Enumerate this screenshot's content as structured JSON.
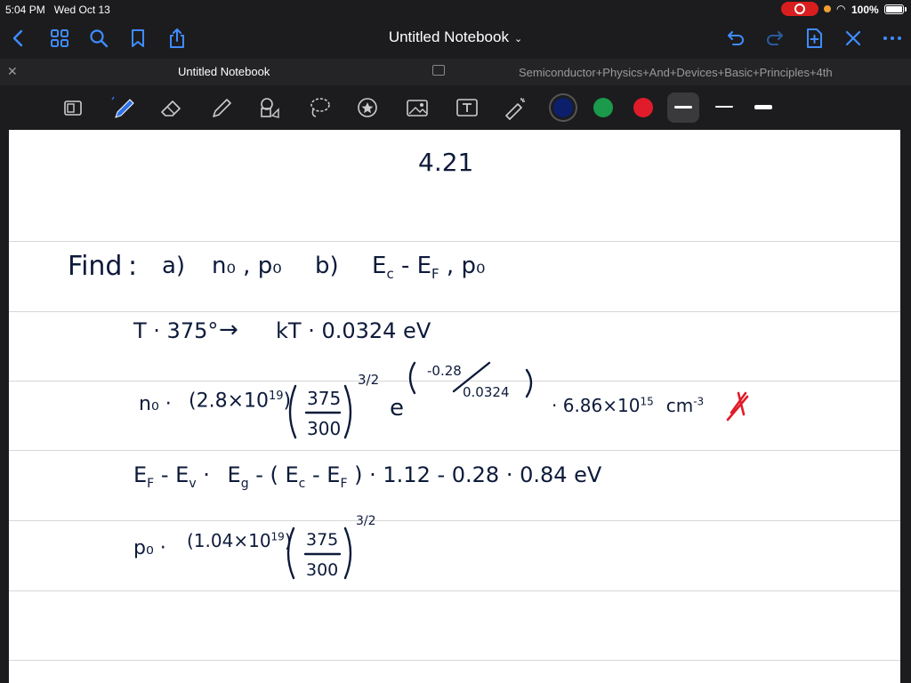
{
  "status_bar": {
    "time": "5:04 PM",
    "date": "Wed Oct 13",
    "battery": "100%"
  },
  "nav": {
    "title": "Untitled Notebook"
  },
  "tabs": [
    {
      "label": "Untitled Notebook"
    },
    {
      "label": "Semiconductor+Physics+And+Devices+Basic+Principles+4th"
    }
  ],
  "colors": {
    "accent": "#3f8cff",
    "ink": "#0d1a3a",
    "swatch_navy": "#0b1f6b",
    "swatch_green": "#1a9a4a",
    "swatch_red": "#e01c2a"
  },
  "note": {
    "problem_number": "4.21",
    "find": {
      "label": "Find",
      "colon": ":",
      "a_label": "a)",
      "a_text": "n₀ , p₀",
      "b_label": "b)",
      "b_text": "E",
      "b_sub1": "c",
      "b_mid": " - E",
      "b_sub2": "F",
      "b_tail": " , p₀"
    },
    "line_T": {
      "lhs": "T · 375°",
      "arrow": "→",
      "rhs": "kT · 0.0324 eV"
    },
    "line_n0": {
      "lhs": "n₀ ·",
      "coef": "(2.8×10",
      "coef_exp": "19",
      "coef_close": ")",
      "frac_num": "375",
      "frac_den": "300",
      "power": "3/2",
      "e": "e",
      "exp_num": "-0.28",
      "exp_den": "0.0324",
      "result": "· 6.86×10",
      "result_exp": "15",
      "unit": "cm",
      "unit_exp": "-3"
    },
    "line_EF": {
      "lhs": "E",
      "lhs_sub1": "F",
      "lhs_mid": " - E",
      "lhs_sub2": "v",
      "eq": " · ",
      "rhs1": "E",
      "rhs1_sub": "g",
      "rhs2": " - ( E",
      "rhs2_sub1": "c",
      "rhs3": " - E",
      "rhs3_sub2": "F",
      "rhs4": " ) · 1.12 - 0.28 · 0.84 eV"
    },
    "line_p0": {
      "lhs": "p₀ ·",
      "coef": "(1.04×10",
      "coef_exp": "19",
      "coef_close": ")",
      "frac_num": "375",
      "frac_den": "300",
      "power": "3/2"
    }
  }
}
